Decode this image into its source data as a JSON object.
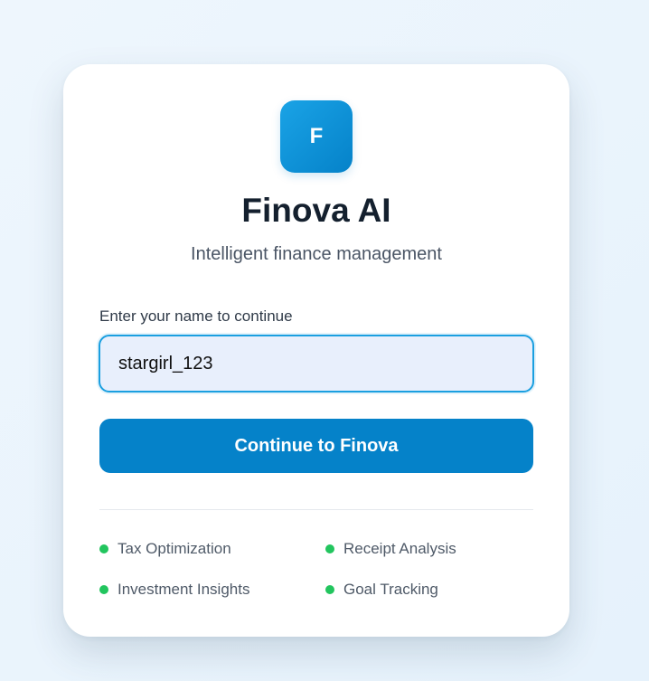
{
  "brand": {
    "logo_letter": "F",
    "title": "Finova AI",
    "subtitle": "Intelligent finance management"
  },
  "form": {
    "name_label": "Enter your name to continue",
    "name_value": "stargirl_123",
    "continue_label": "Continue to Finova"
  },
  "features": [
    {
      "label": "Tax Optimization"
    },
    {
      "label": "Receipt Analysis"
    },
    {
      "label": "Investment Insights"
    },
    {
      "label": "Goal Tracking"
    }
  ],
  "colors": {
    "accent": "#0582c9",
    "feature_dot": "#22c55e",
    "input_background": "#e8effc"
  }
}
